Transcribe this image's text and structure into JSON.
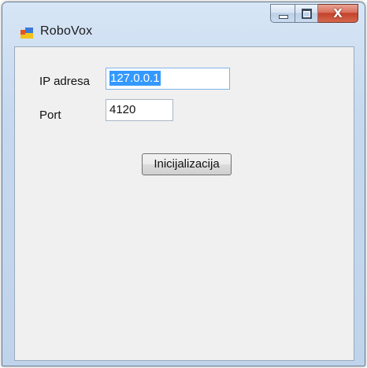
{
  "window": {
    "title": "RoboVox",
    "icon": "winforms-app-icon",
    "close_glyph": "X"
  },
  "form": {
    "ip_label": "IP adresa",
    "ip_value": "127.0.0.1",
    "port_label": "Port",
    "port_value": "4120",
    "init_button": "Inicijalizacija"
  },
  "colors": {
    "selection": "#3399ff",
    "close_button": "#c4402a"
  }
}
